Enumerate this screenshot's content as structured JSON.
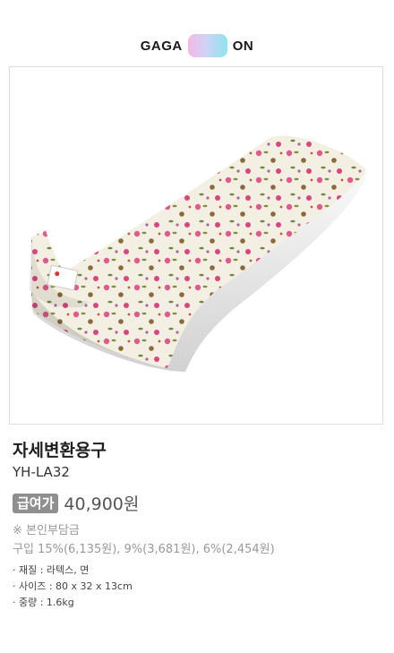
{
  "logo": {
    "left_text": "GAGA",
    "right_text": "ON"
  },
  "product": {
    "name": "자세변환용구",
    "model": "YH-LA32",
    "badge": "급여가",
    "price": "40,900원",
    "note": "※ 본인부담금",
    "purchase": "구입 15%(6,135원), 9%(3,681원), 6%(2,454원)",
    "specs": [
      "· 재질 : 라텍스, 면",
      "· 사이즈 : 80 x 32 x 13cm",
      "· 중량 : 1.6kg"
    ]
  },
  "colors": {
    "badge": "#8f8f8f",
    "price": "#555555",
    "note": "#999999"
  }
}
